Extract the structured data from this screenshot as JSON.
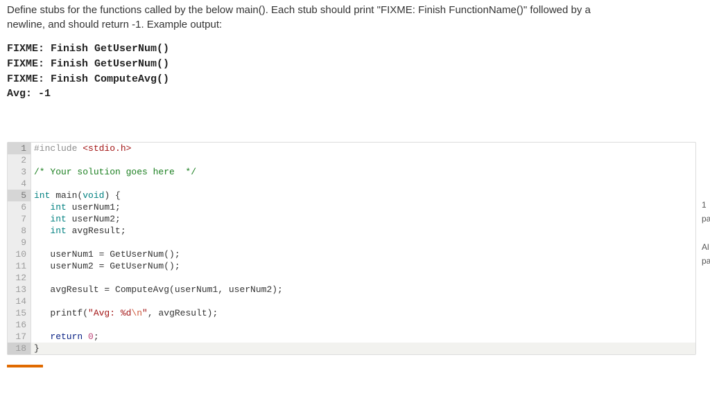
{
  "instructions_line1": "Define stubs for the functions called by the below main(). Each stub should print \"FIXME: Finish FunctionName()\" followed by a",
  "instructions_line2": "newline, and should return -1. Example output:",
  "example_output": "FIXME: Finish GetUserNum()\nFIXME: Finish GetUserNum()\nFIXME: Finish ComputeAvg()\nAvg: -1",
  "code": {
    "lines": [
      {
        "n": 1,
        "hl": true,
        "sel": false,
        "tokens": [
          {
            "c": "tok-pp",
            "t": "#include "
          },
          {
            "c": "tok-str",
            "t": "<stdio.h>"
          }
        ]
      },
      {
        "n": 2,
        "hl": false,
        "sel": false,
        "tokens": [
          {
            "c": "",
            "t": ""
          }
        ]
      },
      {
        "n": 3,
        "hl": false,
        "sel": false,
        "tokens": [
          {
            "c": "tok-cm",
            "t": "/* Your solution goes here  */"
          }
        ]
      },
      {
        "n": 4,
        "hl": false,
        "sel": false,
        "tokens": [
          {
            "c": "",
            "t": ""
          }
        ]
      },
      {
        "n": 5,
        "hl": true,
        "sel": false,
        "tokens": [
          {
            "c": "tok-ty",
            "t": "int"
          },
          {
            "c": "",
            "t": " main("
          },
          {
            "c": "tok-ty",
            "t": "void"
          },
          {
            "c": "",
            "t": ") {"
          }
        ]
      },
      {
        "n": 6,
        "hl": false,
        "sel": false,
        "tokens": [
          {
            "c": "",
            "t": "   "
          },
          {
            "c": "tok-ty",
            "t": "int"
          },
          {
            "c": "",
            "t": " userNum1;"
          }
        ]
      },
      {
        "n": 7,
        "hl": false,
        "sel": false,
        "tokens": [
          {
            "c": "",
            "t": "   "
          },
          {
            "c": "tok-ty",
            "t": "int"
          },
          {
            "c": "",
            "t": " userNum2;"
          }
        ]
      },
      {
        "n": 8,
        "hl": false,
        "sel": false,
        "tokens": [
          {
            "c": "",
            "t": "   "
          },
          {
            "c": "tok-ty",
            "t": "int"
          },
          {
            "c": "",
            "t": " avgResult;"
          }
        ]
      },
      {
        "n": 9,
        "hl": false,
        "sel": false,
        "tokens": [
          {
            "c": "",
            "t": ""
          }
        ]
      },
      {
        "n": 10,
        "hl": false,
        "sel": false,
        "tokens": [
          {
            "c": "",
            "t": "   userNum1 = GetUserNum();"
          }
        ]
      },
      {
        "n": 11,
        "hl": false,
        "sel": false,
        "tokens": [
          {
            "c": "",
            "t": "   userNum2 = GetUserNum();"
          }
        ]
      },
      {
        "n": 12,
        "hl": false,
        "sel": false,
        "tokens": [
          {
            "c": "",
            "t": ""
          }
        ]
      },
      {
        "n": 13,
        "hl": false,
        "sel": false,
        "tokens": [
          {
            "c": "",
            "t": "   avgResult = ComputeAvg(userNum1, userNum2);"
          }
        ]
      },
      {
        "n": 14,
        "hl": false,
        "sel": false,
        "tokens": [
          {
            "c": "",
            "t": ""
          }
        ]
      },
      {
        "n": 15,
        "hl": false,
        "sel": false,
        "tokens": [
          {
            "c": "",
            "t": "   printf("
          },
          {
            "c": "tok-str",
            "t": "\"Avg: %d"
          },
          {
            "c": "tok-esc",
            "t": "\\n"
          },
          {
            "c": "tok-str",
            "t": "\""
          },
          {
            "c": "",
            "t": ", avgResult);"
          }
        ]
      },
      {
        "n": 16,
        "hl": false,
        "sel": false,
        "tokens": [
          {
            "c": "",
            "t": ""
          }
        ]
      },
      {
        "n": 17,
        "hl": false,
        "sel": false,
        "tokens": [
          {
            "c": "",
            "t": "   "
          },
          {
            "c": "tok-kw",
            "t": "return"
          },
          {
            "c": "",
            "t": " "
          },
          {
            "c": "tok-num",
            "t": "0"
          },
          {
            "c": "",
            "t": ";"
          }
        ]
      },
      {
        "n": 18,
        "hl": false,
        "sel": true,
        "tokens": [
          {
            "c": "",
            "t": "}"
          }
        ]
      }
    ]
  },
  "side": {
    "a": "1",
    "b": "pa",
    "c": "Al",
    "d": "pa"
  }
}
